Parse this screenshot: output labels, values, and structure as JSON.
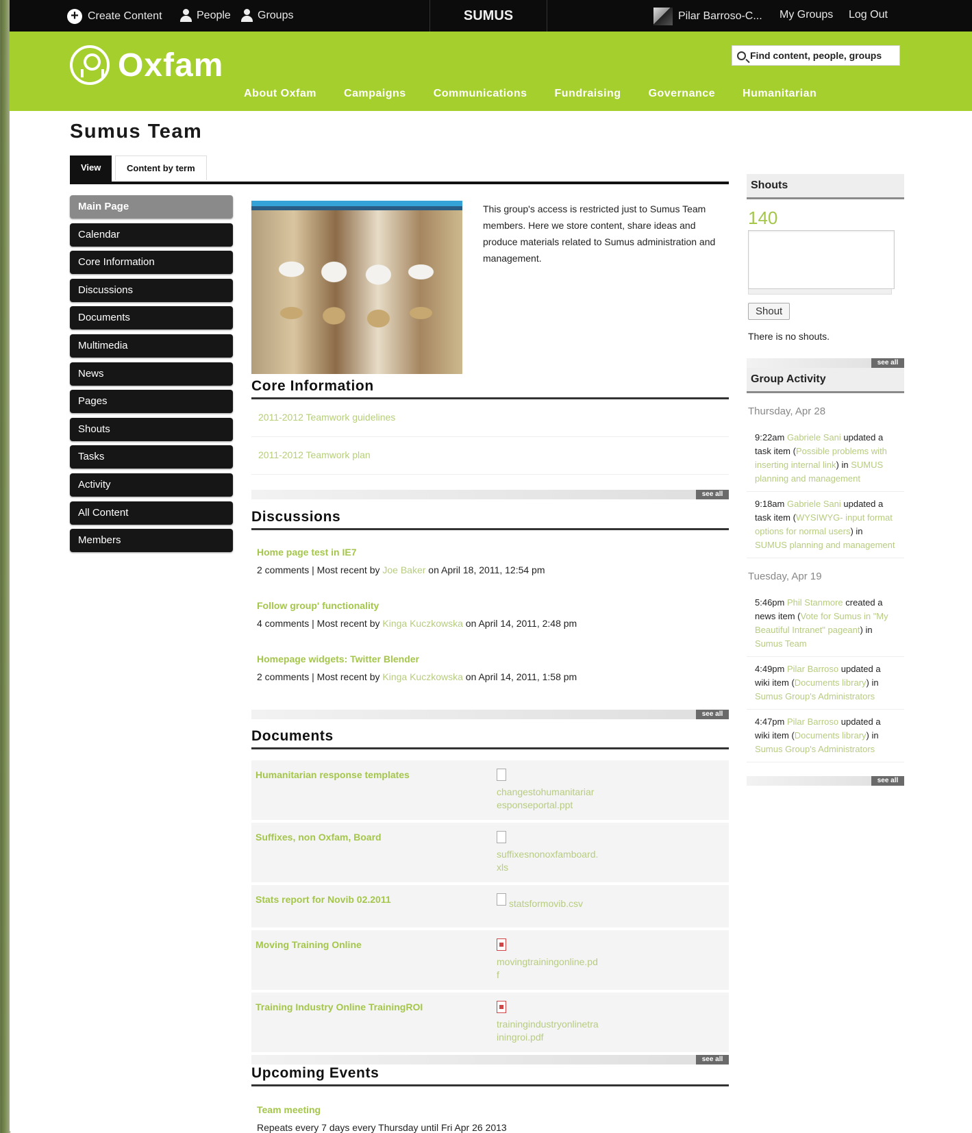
{
  "topbar": {
    "create_content": "Create Content",
    "people": "People",
    "groups": "Groups",
    "site_name": "SUMUS",
    "user_name": "Pilar Barroso-C...",
    "my_groups": "My Groups",
    "log_out": "Log Out"
  },
  "header": {
    "logo_text": "Oxfam",
    "search_placeholder": "Find content, people, groups",
    "nav": [
      "About Oxfam",
      "Campaigns",
      "Communications",
      "Fundraising",
      "Governance",
      "Humanitarian"
    ],
    "brand_color": "#a4cf2c"
  },
  "page": {
    "title": "Sumus Team",
    "tabs": [
      "View",
      "Content by term"
    ]
  },
  "sidebar": {
    "items": [
      "Main Page",
      "Calendar",
      "Core Information",
      "Discussions",
      "Documents",
      "Multimedia",
      "News",
      "Pages",
      "Shouts",
      "Tasks",
      "Activity",
      "All Content",
      "Members"
    ]
  },
  "main": {
    "intro": "This group's access is restricted just to Sumus Team members. Here we store content, share ideas and produce materials related to Sumus administration and management.",
    "see_all": "see all",
    "core": {
      "heading": "Core Information",
      "links": [
        "2011-2012 Teamwork guidelines",
        "2011-2012 Teamwork plan"
      ]
    },
    "discussions": {
      "heading": "Discussions",
      "items": [
        {
          "title": "Home page test in IE7",
          "comments": "2 comments",
          "sep": " | Most recent by ",
          "who": "Joe Baker",
          "when": " on April 18, 2011, 12:54 pm"
        },
        {
          "title": "Follow group' functionality",
          "comments": "4 comments",
          "sep": " | Most recent by ",
          "who": "Kinga Kuczkowska",
          "when": " on April 14, 2011, 2:48 pm"
        },
        {
          "title": "Homepage widgets: Twitter Blender",
          "comments": "2 comments",
          "sep": " | Most recent by ",
          "who": "Kinga Kuczkowska",
          "when": " on April 14, 2011, 1:58 pm"
        }
      ]
    },
    "documents": {
      "heading": "Documents",
      "items": [
        {
          "title": "Humanitarian response templates",
          "file": "changestohumanitariaresponseportal.ppt",
          "icon": "document-icon"
        },
        {
          "title": "Suffixes, non Oxfam, Board",
          "file": "suffixesnonoxfamboard.xls",
          "icon": "document-icon"
        },
        {
          "title": "Stats report for Novib 02.2011",
          "file": "statsformovib.csv",
          "icon": "document-icon"
        },
        {
          "title": "Moving Training Online",
          "file": "movingtrainingonline.pdf",
          "icon": "pdf-icon"
        },
        {
          "title": "Training Industry Online TrainingROI",
          "file": "trainingindustryonlinetrainingroi.pdf",
          "icon": "pdf-icon"
        }
      ]
    },
    "events": {
      "heading": "Upcoming Events",
      "title": "Team meeting",
      "repeat": "Repeats every 7 days every Thursday until Fri Apr 26 2013"
    }
  },
  "right": {
    "shouts": {
      "heading": "Shouts",
      "counter": "140",
      "button": "Shout",
      "empty": "There is no shouts."
    },
    "activity": {
      "heading": "Group Activity",
      "see_all": "see all",
      "groups": [
        {
          "date": "Thursday, Apr 28",
          "items": [
            {
              "time": "9:22am ",
              "who": "Gabriele Sani",
              "action": " updated a task item (",
              "what": "Possible problems with inserting internal link",
              "in": ") in ",
              "group": "SUMUS planning and management"
            },
            {
              "time": "9:18am ",
              "who": "Gabriele Sani",
              "action": " updated a task item (",
              "what": "WYSIWYG- input format options for normal users",
              "in": ") in ",
              "group": "SUMUS planning and management"
            }
          ]
        },
        {
          "date": "Tuesday, Apr 19",
          "items": [
            {
              "time": "5:46pm ",
              "who": "Phil Stanmore",
              "action": " created a news item (",
              "what": "Vote for Sumus in \"My Beautiful Intranet\" pageant",
              "in": ") in ",
              "group": "Sumus Team"
            },
            {
              "time": "4:49pm ",
              "who": "Pilar Barroso",
              "action": " updated a wiki item (",
              "what": "Documents library",
              "in": ") in ",
              "group": "Sumus Group's Administrators"
            },
            {
              "time": "4:47pm ",
              "who": "Pilar Barroso",
              "action": " updated a wiki item (",
              "what": "Documents library",
              "in": ") in ",
              "group": "Sumus Group's Administrators"
            }
          ]
        }
      ]
    }
  }
}
